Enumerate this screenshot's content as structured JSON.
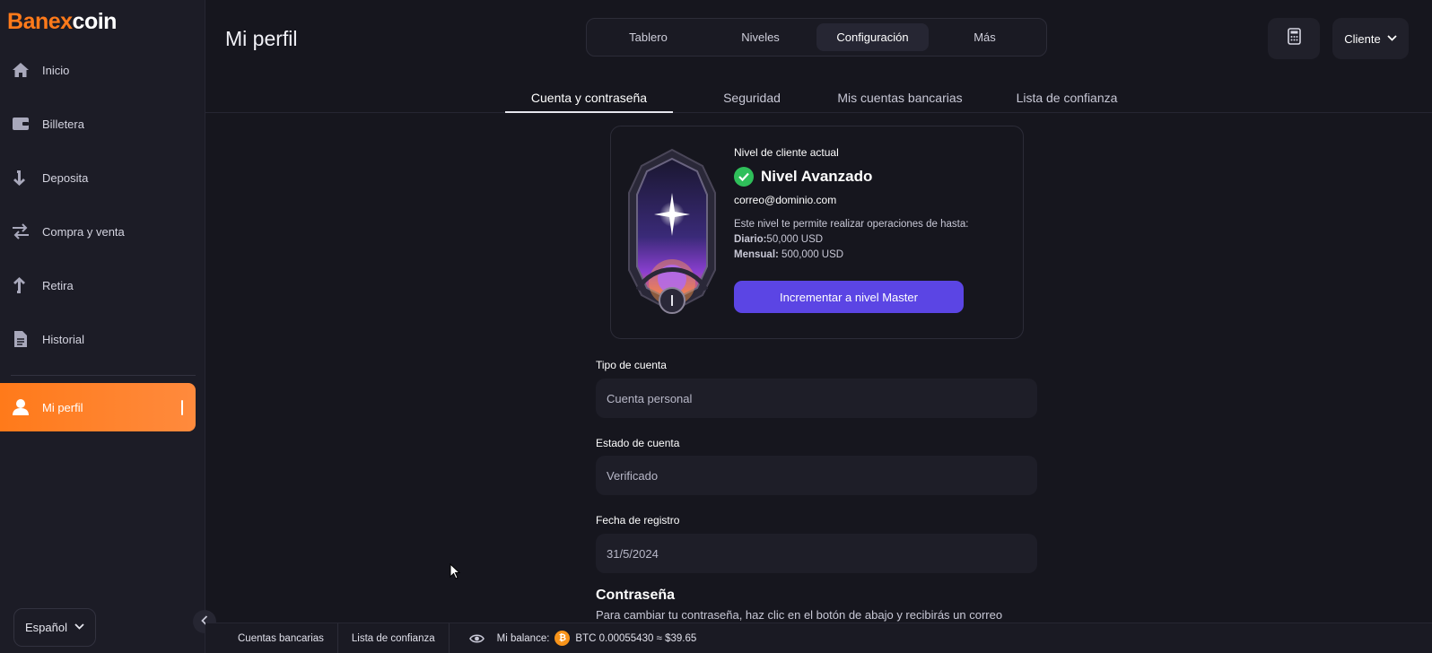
{
  "brand": {
    "logo_b": "B",
    "logo_rest": "anex",
    "logo_coin": "coin",
    "accent": "#ff7a1a"
  },
  "sidebar": {
    "items": [
      {
        "label": "Inicio",
        "icon": "home-icon"
      },
      {
        "label": "Billetera",
        "icon": "wallet-icon"
      },
      {
        "label": "Deposita",
        "icon": "arrow-down-icon"
      },
      {
        "label": "Compra y venta",
        "icon": "swap-icon"
      },
      {
        "label": "Retira",
        "icon": "arrow-up-icon"
      },
      {
        "label": "Historial",
        "icon": "document-icon"
      },
      {
        "label": "Mi perfil",
        "icon": "user-icon",
        "active": true
      }
    ],
    "language": "Español"
  },
  "header": {
    "title": "Mi perfil",
    "tabs": [
      "Tablero",
      "Niveles",
      "Configuración",
      "Más"
    ],
    "active_tab": "Configuración",
    "client_label": "Cliente"
  },
  "sub_tabs": [
    "Cuenta y contraseña",
    "Seguridad",
    "Mis cuentas bancarias",
    "Lista de confianza"
  ],
  "level_card": {
    "label": "Nivel de cliente actual",
    "level_name": "Nivel Avanzado",
    "email": "correo@dominio.com",
    "description": "Este nivel te permite realizar operaciones de hasta:",
    "daily_label": "Diario:",
    "daily_value": "50,000 USD",
    "monthly_label": "Mensual:",
    "monthly_value": "500,000 USD",
    "upgrade_button": "Incrementar a nivel Master",
    "badge_numeral": "I"
  },
  "fields": {
    "account_type": {
      "label": "Tipo de cuenta",
      "value": "Cuenta personal"
    },
    "account_status": {
      "label": "Estado de cuenta",
      "value": "Verificado"
    },
    "register_date": {
      "label": "Fecha de registro",
      "value": "31/5/2024"
    }
  },
  "password": {
    "title": "Contraseña",
    "description": "Para cambiar tu contraseña, haz clic en el botón de abajo y recibirás un correo"
  },
  "footer": {
    "bank_accounts": "Cuentas bancarias",
    "trust_list": "Lista de confianza",
    "balance_label": "Mi balance:",
    "balance_value": "BTC 0.00055430 ≈ $39.65"
  }
}
